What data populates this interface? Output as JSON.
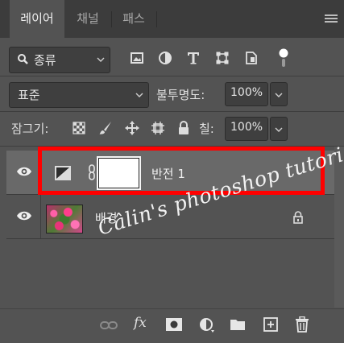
{
  "tabs": [
    {
      "label": "레이어",
      "active": true
    },
    {
      "label": "채널",
      "active": false
    },
    {
      "label": "패스",
      "active": false
    }
  ],
  "filter": {
    "kind_label": "종류",
    "icons": [
      "image-filter-icon",
      "adjustment-filter-icon",
      "type-filter-icon",
      "shape-filter-icon",
      "smart-object-filter-icon",
      "filter-toggle-icon"
    ]
  },
  "blend": {
    "mode": "표준",
    "opacity_label": "불투명도:",
    "opacity_value": "100%"
  },
  "lock": {
    "label": "잠그기:",
    "icons": [
      "lock-transparent-icon",
      "lock-image-icon",
      "lock-position-icon",
      "lock-artboard-icon",
      "lock-all-icon"
    ],
    "fill_label": "칠:",
    "fill_value": "100%"
  },
  "layers": [
    {
      "name": "반전 1",
      "type": "adjustment",
      "selected": true,
      "visible": true
    },
    {
      "name": "배경",
      "type": "background",
      "selected": false,
      "visible": true,
      "locked": true
    }
  ],
  "watermark": "Câlin's photoshop tutorials",
  "bottom_icons": [
    "link-icon",
    "fx-icon",
    "mask-icon",
    "adjustment-layer-icon",
    "group-folder-icon",
    "new-layer-icon",
    "trash-icon"
  ],
  "fx_label": "fx",
  "colors": {
    "panel": "#535353",
    "selected_layer": "#696969",
    "highlight": "#ff0000"
  }
}
